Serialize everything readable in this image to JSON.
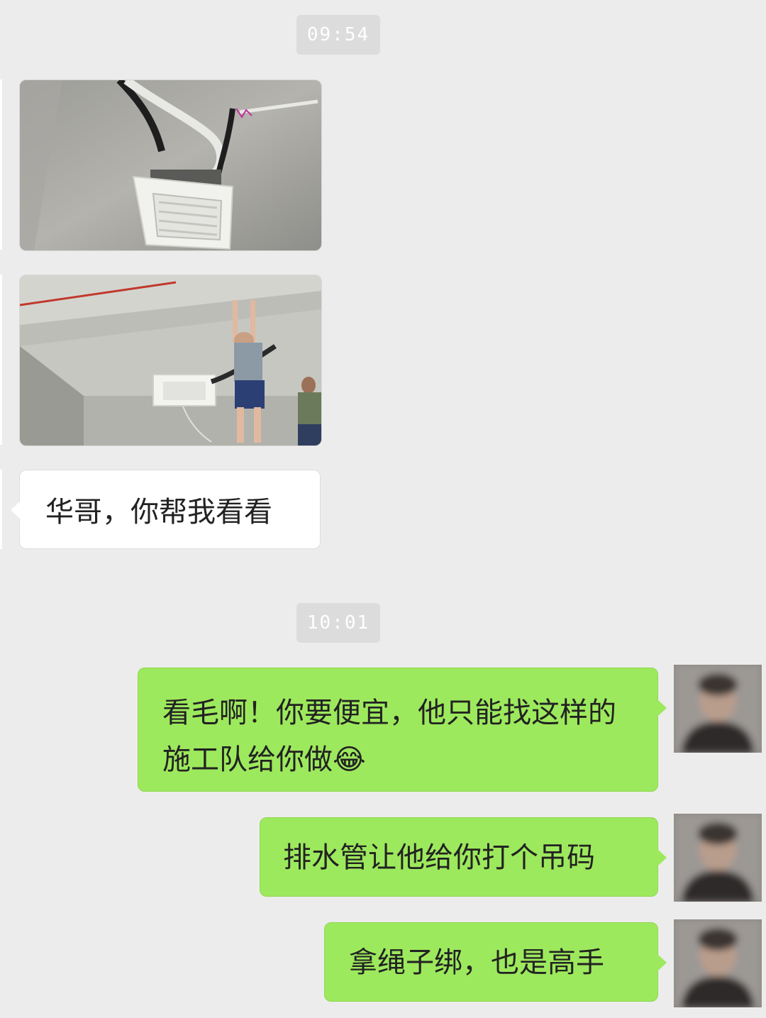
{
  "timestamps": [
    "09:54",
    "10:01"
  ],
  "messages": {
    "incoming_text": "华哥，你帮我看看",
    "outgoing_1": "看毛啊！你要便宜，他只能找这样的施工队给你做",
    "outgoing_1_emoji": "😂",
    "outgoing_2": "排水管让他给你打个吊码",
    "outgoing_3": "拿绳子绑，也是高手"
  },
  "icons": {
    "avatar": "blurred-avatar-icon",
    "emoji": "tears-of-joy-emoji"
  },
  "colors": {
    "background": "#ececec",
    "outgoing_bubble": "#9de95d",
    "incoming_bubble": "#ffffff",
    "timestamp_bg": "#dcdcdc"
  }
}
